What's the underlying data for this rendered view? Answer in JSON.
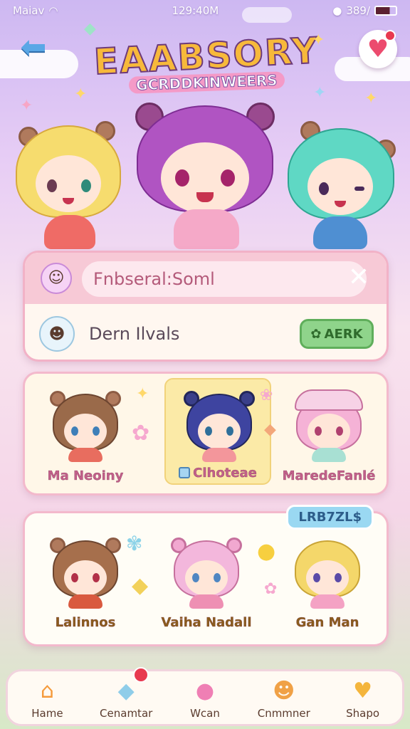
{
  "status_bar": {
    "carrier": "Maiav",
    "time": "129:40M",
    "battery_text": "389/"
  },
  "header": {
    "logo_title": "EAABSORY",
    "logo_subtitle": "GCRDDKINWEERS"
  },
  "search": {
    "query": "Fnbseral:Soml"
  },
  "result": {
    "label": "Dern Ilvals",
    "add_label": "AERK"
  },
  "panel1": {
    "cards": [
      {
        "label": "Ma Neoiny"
      },
      {
        "label": "Clhoteae",
        "selected": true
      },
      {
        "label": "MaredeFanlé"
      }
    ]
  },
  "panel2": {
    "badge": "LRB7ZL$",
    "cards": [
      {
        "label": "Lalinnos"
      },
      {
        "label": "Vaiha Nadall"
      },
      {
        "label": "Gan Man"
      }
    ]
  },
  "tabs": [
    {
      "label": "Hame",
      "icon": "house-icon"
    },
    {
      "label": "Cenamtar",
      "icon": "chat-icon"
    },
    {
      "label": "Wcan",
      "icon": "bubbles-icon"
    },
    {
      "label": "Cnmmner",
      "icon": "bear-icon"
    },
    {
      "label": "Shapo",
      "icon": "heart-shop-icon"
    }
  ],
  "colors": {
    "accent_pink": "#f7c9d6",
    "panel_border": "#f3b9cc",
    "add_button": "#8fd48b",
    "badge_blue": "#9ad8f2",
    "heart_red": "#ec4b6e"
  }
}
